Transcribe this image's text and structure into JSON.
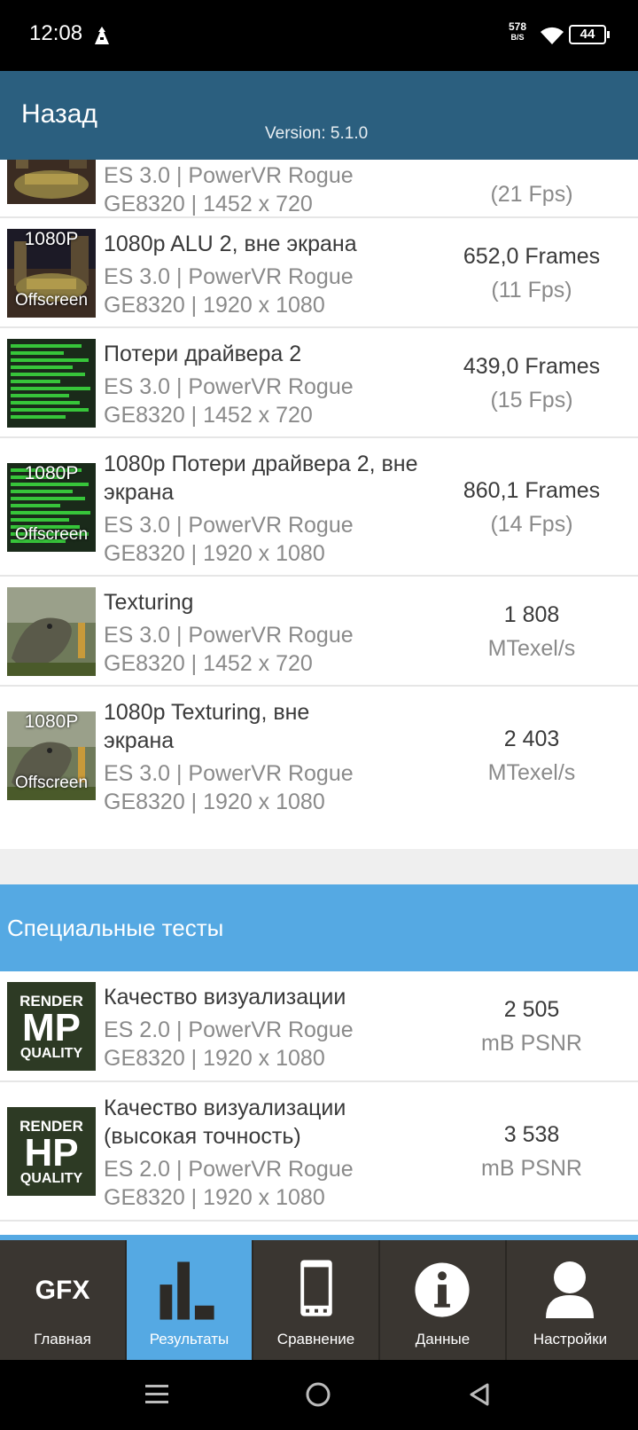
{
  "status_bar": {
    "time": "12:08",
    "net_speed_value": "578",
    "net_speed_unit": "B/S",
    "battery": "44"
  },
  "app_bar": {
    "back_label": "Назад",
    "version": "Version: 5.1.0"
  },
  "results": [
    {
      "thumb": "city",
      "badge": "",
      "title": "",
      "sub1": "ES 3.0 | PowerVR Rogue",
      "sub2": "GE8320 | 1452 x 720",
      "value": "",
      "unit": "(21 Fps)"
    },
    {
      "thumb": "city",
      "badge": "1080P",
      "badge2": "Offscreen",
      "title": "1080p ALU 2, вне экрана",
      "sub1": "ES 3.0 | PowerVR Rogue",
      "sub2": "GE8320 | 1920 x 1080",
      "value": "652,0 Frames",
      "unit": "(11 Fps)"
    },
    {
      "thumb": "green",
      "badge": "",
      "title": "Потери драйвера 2",
      "sub1": "ES 3.0 | PowerVR Rogue",
      "sub2": "GE8320 | 1452 x 720",
      "value": "439,0 Frames",
      "unit": "(15 Fps)"
    },
    {
      "thumb": "green",
      "badge": "1080P",
      "badge2": "Offscreen",
      "title": "1080p Потери драйвера 2, вне экрана",
      "sub1": "ES 3.0 | PowerVR Rogue",
      "sub2": "GE8320 | 1920 x 1080",
      "value": "860,1 Frames",
      "unit": "(14 Fps)"
    },
    {
      "thumb": "dino",
      "badge": "",
      "title": "Texturing",
      "sub1": "ES 3.0 | PowerVR Rogue",
      "sub2": "GE8320 | 1452 x 720",
      "value": "1 808",
      "unit": "MTexel/s"
    },
    {
      "thumb": "dino",
      "badge": "1080P",
      "badge2": "Offscreen",
      "title": "1080p Texturing, вне экрана",
      "sub1": "ES 3.0 | PowerVR Rogue",
      "sub2": "GE8320 | 1920 x 1080",
      "value": "2 403",
      "unit": "MTexel/s"
    }
  ],
  "special_section": {
    "title": "Специальные тесты"
  },
  "special_results": [
    {
      "thumb_top": "RENDER",
      "thumb_big": "MP",
      "thumb_bottom": "QUALITY",
      "title": "Качество визуализации",
      "sub1": "ES 2.0 | PowerVR Rogue",
      "sub2": "GE8320 | 1920 x 1080",
      "value": "2 505",
      "unit": "mB PSNR"
    },
    {
      "thumb_top": "RENDER",
      "thumb_big": "HP",
      "thumb_bottom": "QUALITY",
      "title": "Качество визуализации (высокая точность)",
      "sub1": "ES 2.0 | PowerVR Rogue",
      "sub2": "GE8320 | 1920 x 1080",
      "value": "3 538",
      "unit": "mB PSNR"
    }
  ],
  "bottom_nav": [
    {
      "label": "Главная",
      "icon": "gfx-logo-icon",
      "icon_text": "GFX"
    },
    {
      "label": "Результаты",
      "icon": "bar-chart-icon",
      "active": true
    },
    {
      "label": "Сравнение",
      "icon": "phone-icon"
    },
    {
      "label": "Данные",
      "icon": "info-icon"
    },
    {
      "label": "Настройки",
      "icon": "user-icon"
    }
  ],
  "colors": {
    "app_bar": "#2b5f7f",
    "accent": "#55a9e3",
    "nav_bg": "#3a3631"
  }
}
